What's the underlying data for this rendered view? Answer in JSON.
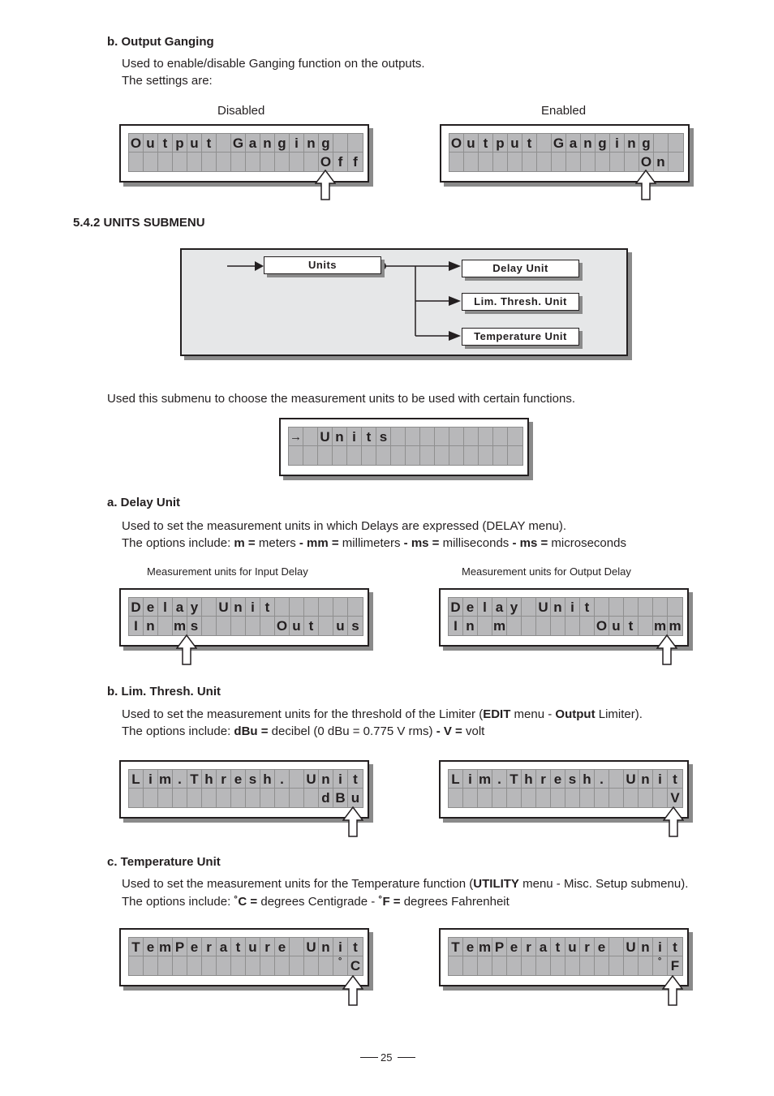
{
  "section_b_output_ganging": {
    "heading": "b. Output Ganging",
    "line1": "Used to enable/disable Ganging function on the outputs.",
    "line2": "The settings are:",
    "label_disabled": "Disabled",
    "label_enabled": "Enabled",
    "lcd_disabled": {
      "row1": [
        "O",
        "u",
        "t",
        "p",
        "u",
        "t",
        "",
        "G",
        "a",
        "n",
        "g",
        "i",
        "n",
        "g",
        "",
        ""
      ],
      "row2": [
        "",
        "",
        "",
        "",
        "",
        "",
        "",
        "",
        "",
        "",
        "",
        "",
        "",
        "O",
        "f",
        "f"
      ]
    },
    "lcd_enabled": {
      "row1": [
        "O",
        "u",
        "t",
        "p",
        "u",
        "t",
        "",
        "G",
        "a",
        "n",
        "g",
        "i",
        "n",
        "g",
        "",
        ""
      ],
      "row2": [
        "",
        "",
        "",
        "",
        "",
        "",
        "",
        "",
        "",
        "",
        "",
        "",
        "",
        "O",
        "n",
        ""
      ]
    }
  },
  "units_submenu": {
    "heading": "5.4.2 UNITS SUBMENU",
    "diagram": {
      "root": "Units",
      "children": [
        "Delay Unit",
        "Lim. Thresh. Unit",
        "Temperature Unit"
      ]
    },
    "description": "Used this submenu to choose the measurement units to be used with certain functions.",
    "lcd_units": {
      "row1": [
        "→",
        "",
        "U",
        "n",
        "i",
        "t",
        "s",
        "",
        "",
        "",
        "",
        "",
        "",
        "",
        "",
        ""
      ],
      "row2": [
        "",
        "",
        "",
        "",
        "",
        "",
        "",
        "",
        "",
        "",
        "",
        "",
        "",
        "",
        "",
        ""
      ]
    }
  },
  "delay_unit": {
    "heading": "a. Delay Unit",
    "line1": "Used to set the measurement units in which Delays are expressed (DELAY menu).",
    "line2_prefix": "The options include: ",
    "options": [
      {
        "key": "m =",
        "desc": " meters "
      },
      {
        "key": "- mm =",
        "desc": " millimeters "
      },
      {
        "key": "- ms =",
        "desc": " milliseconds "
      },
      {
        "key": "- ms =",
        "desc": " microseconds"
      }
    ],
    "caption_input": "Measurement units for Input Delay",
    "caption_output": "Measurement units for Output Delay",
    "lcd_input": {
      "row1": [
        "D",
        "e",
        "l",
        "a",
        "y",
        "",
        "U",
        "n",
        "i",
        "t",
        "",
        "",
        "",
        "",
        "",
        ""
      ],
      "row2": [
        "I",
        "n",
        "",
        "m",
        "s",
        "",
        "",
        "",
        "",
        "",
        "O",
        "u",
        "t",
        "",
        "u",
        "s"
      ]
    },
    "lcd_output": {
      "row1": [
        "D",
        "e",
        "l",
        "a",
        "y",
        "",
        "U",
        "n",
        "i",
        "t",
        "",
        "",
        "",
        "",
        "",
        ""
      ],
      "row2": [
        "I",
        "n",
        "",
        "m",
        "",
        "",
        "",
        "",
        "",
        "",
        "O",
        "u",
        "t",
        "",
        "m",
        "m"
      ]
    }
  },
  "lim_thresh_unit": {
    "heading": "b. Lim. Thresh. Unit",
    "line1_a": "Used to set the measurement units for the threshold of the Limiter (",
    "line1_b": "EDIT",
    "line1_c": " menu - ",
    "line1_d": "Output",
    "line1_e": " Limiter).",
    "line2_prefix": "The options include: ",
    "opt1_key": "dBu =",
    "opt1_desc": " decibel (0 dBu = 0.775 V rms) ",
    "opt2_key": "- V =",
    "opt2_desc": " volt",
    "lcd_dbu": {
      "row1": [
        "L",
        "i",
        "m",
        ".",
        "T",
        "h",
        "r",
        "e",
        "s",
        "h",
        ".",
        "",
        "U",
        "n",
        "i",
        "t"
      ],
      "row2": [
        "",
        "",
        "",
        "",
        "",
        "",
        "",
        "",
        "",
        "",
        "",
        "",
        "",
        "d",
        "B",
        "u"
      ]
    },
    "lcd_v": {
      "row1": [
        "L",
        "i",
        "m",
        ".",
        "T",
        "h",
        "r",
        "e",
        "s",
        "h",
        ".",
        "",
        "U",
        "n",
        "i",
        "t"
      ],
      "row2": [
        "",
        "",
        "",
        "",
        "",
        "",
        "",
        "",
        "",
        "",
        "",
        "",
        "",
        "",
        "",
        "V"
      ]
    }
  },
  "temperature_unit": {
    "heading": "c. Temperature Unit",
    "line1_a": "Used to set the measurement units for the Temperature function (",
    "line1_b": "UTILITY",
    "line1_c": " menu - Misc. Setup submenu).",
    "line2_prefix": "The options include: ",
    "opt1_key": "˚C =",
    "opt1_desc": " degrees Centigrade - ",
    "opt2_key": "˚F =",
    "opt2_desc": " degrees Fahrenheit",
    "lcd_c": {
      "row1": [
        "T",
        "e",
        "m",
        "P",
        "e",
        "r",
        "a",
        "t",
        "u",
        "r",
        "e",
        "",
        "U",
        "n",
        "i",
        "t"
      ],
      "row2": [
        "",
        "",
        "",
        "",
        "",
        "",
        "",
        "",
        "",
        "",
        "",
        "",
        "",
        "",
        "˚",
        "C"
      ]
    },
    "lcd_f": {
      "row1": [
        "T",
        "e",
        "m",
        "P",
        "e",
        "r",
        "a",
        "t",
        "u",
        "r",
        "e",
        "",
        "U",
        "n",
        "i",
        "t"
      ],
      "row2": [
        "",
        "",
        "",
        "",
        "",
        "",
        "",
        "",
        "",
        "",
        "",
        "",
        "",
        "",
        "˚",
        "F"
      ]
    }
  },
  "footer": {
    "page_number": "25"
  }
}
